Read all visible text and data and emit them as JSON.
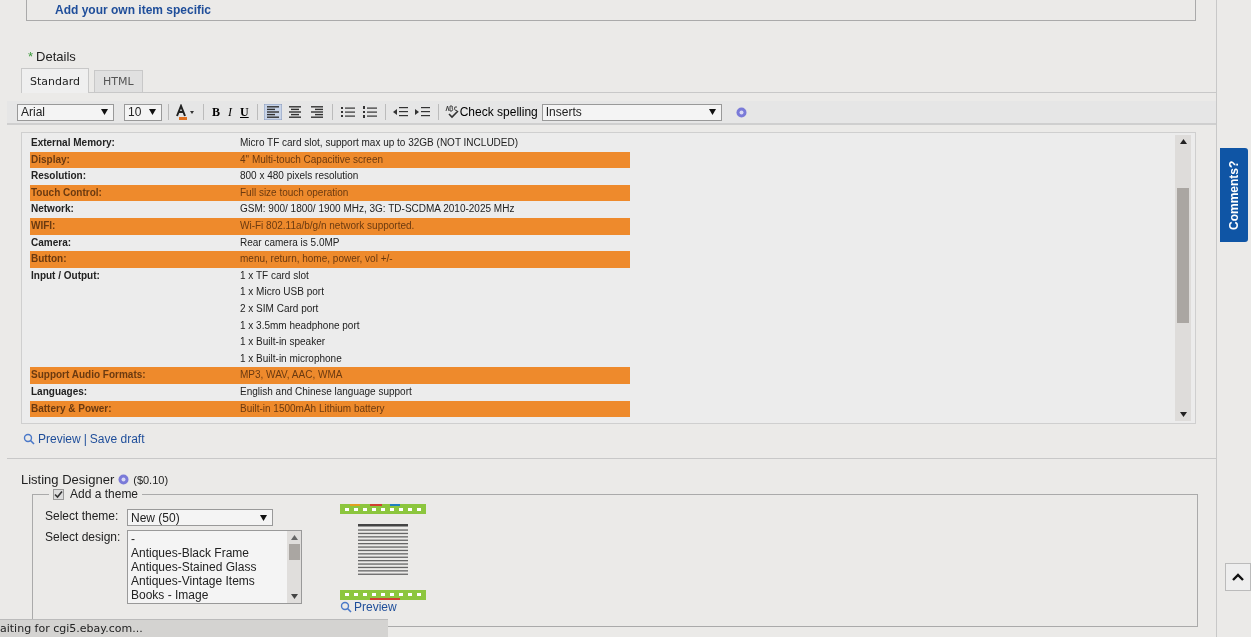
{
  "item_specifics": {
    "add_link": "Add your own item specific"
  },
  "details": {
    "title": "Details",
    "required_mark": "*",
    "tabs": [
      {
        "label": "Standard",
        "selected": true
      },
      {
        "label": "HTML",
        "selected": false
      }
    ],
    "toolbar": {
      "font": "Arial",
      "size": "10",
      "format_buttons": [
        {
          "label": "B",
          "kind": "bold"
        },
        {
          "label": "I",
          "kind": "italic"
        },
        {
          "label": "U",
          "kind": "underline"
        }
      ],
      "align": [
        {
          "kind": "left",
          "selected": true
        },
        {
          "kind": "center",
          "selected": false
        },
        {
          "kind": "right",
          "selected": false
        }
      ],
      "spell": "Check spelling",
      "inserts": "Inserts"
    },
    "spec_rows": [
      {
        "label": "External Memory:",
        "values": [
          "Micro TF card slot, support max up to 32GB (NOT INCLUDED)"
        ],
        "highlighted": false
      },
      {
        "label": "Display:",
        "values": [
          "4\" Multi-touch Capacitive screen"
        ],
        "highlighted": true
      },
      {
        "label": "Resolution:",
        "values": [
          "800 x 480 pixels resolution"
        ],
        "highlighted": false
      },
      {
        "label": "Touch Control:",
        "values": [
          "Full size touch operation"
        ],
        "highlighted": true
      },
      {
        "label": "Network:",
        "values": [
          "GSM: 900/ 1800/ 1900 MHz, 3G: TD-SCDMA 2010-2025 MHz"
        ],
        "highlighted": false
      },
      {
        "label": "WIFI:",
        "values": [
          "Wi-Fi 802.11a/b/g/n network supported."
        ],
        "highlighted": true
      },
      {
        "label": "Camera:",
        "values": [
          "Rear camera is 5.0MP"
        ],
        "highlighted": false
      },
      {
        "label": "Button:",
        "values": [
          "menu, return, home, power, vol +/-"
        ],
        "highlighted": true
      },
      {
        "label": "Input / Output:",
        "values": [
          "1 x TF card slot",
          "1 x Micro USB port",
          "2 x SIM Card port",
          "1 x 3.5mm headphone port",
          "1 x Built-in speaker",
          "1 x Built-in microphone"
        ],
        "highlighted": false
      },
      {
        "label": "Support Audio Formats:",
        "values": [
          "MP3, WAV, AAC, WMA"
        ],
        "highlighted": true
      },
      {
        "label": "Languages:",
        "values": [
          "English and Chinese language support"
        ],
        "highlighted": false
      },
      {
        "label": "Battery & Power:",
        "values": [
          "Built-in 1500mAh Lithium battery"
        ],
        "highlighted": true
      }
    ],
    "preview_link": "Preview",
    "separator": "|",
    "save_link": "Save draft"
  },
  "listing_designer": {
    "title": "Listing Designer",
    "price": "($0.10)",
    "add_theme": {
      "label": "Add a theme",
      "checked": true
    },
    "theme_label": "Select theme:",
    "theme_value": "New (50)",
    "design_label": "Select design:",
    "designs": [
      "-",
      "Antiques-Black Frame",
      "Antiques-Stained Glass",
      "Antiques-Vintage Items",
      "Books - Image"
    ],
    "preview_link": "Preview"
  },
  "comments_tab": "Comments?",
  "status_bar": "aiting for cgi5.ebay.com..."
}
